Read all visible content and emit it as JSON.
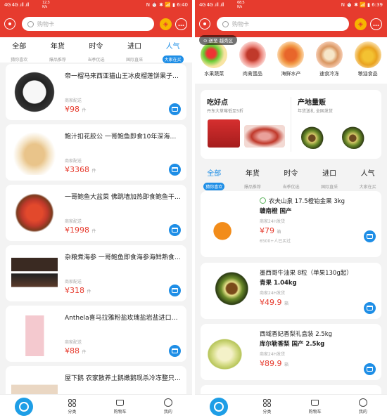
{
  "left": {
    "status": {
      "signal": "4G 4G .ıll .ıll",
      "speed": "12.3\nK/s",
      "time": "6:40",
      "icons": "N ⏰ ✱ 📶 ▮"
    },
    "search_placeholder": "购物卡",
    "tabs": [
      {
        "label": "全部",
        "sub": "猜你喜欢"
      },
      {
        "label": "年货",
        "sub": "爆品推荐"
      },
      {
        "label": "时令",
        "sub": "当季优选"
      },
      {
        "label": "进口",
        "sub": "国际直采"
      },
      {
        "label": "人气",
        "sub": "大家在买"
      }
    ],
    "products": [
      {
        "title": "帝一榴马来西亚猫山王冰皮榴莲饼果子…",
        "store": "商家配送",
        "price": "¥98",
        "unit": "件"
      },
      {
        "title": "鲍汁扣花胶公 一哥鲍鱼即食10年深海…",
        "store": "商家配送",
        "price": "¥3368",
        "unit": "件"
      },
      {
        "title": "一哥鲍鱼大盆菜 佛跳墙加热即食鲍鱼干…",
        "store": "商家配送",
        "price": "¥1998",
        "unit": "件"
      },
      {
        "title": "杂粮煮海参 一哥鲍鱼即食海参海鲜熟食…",
        "store": "商家配送",
        "price": "¥318",
        "unit": "件"
      },
      {
        "title": "Anthela喜马拉雅粉盐玫瑰盐岩盐进口…",
        "store": "商家配送",
        "price": "¥88",
        "unit": "件"
      },
      {
        "title": "屋下鹅 农家散养土鹅嫩鹅现杀冷冻整只…"
      }
    ],
    "nav": [
      "分类",
      "购物车",
      "我的"
    ]
  },
  "right": {
    "status": {
      "signal": "4G 4G .ıll .ıll",
      "speed": "68.5\nK/s",
      "time": "6:39",
      "icons": "N ⏰ ✱ 📶 ▮"
    },
    "search_placeholder": "购物卡",
    "location": "送至 越秀区",
    "categories": [
      "水果蔬菜",
      "肉禽蛋品",
      "海鲜水产",
      "速食冷冻",
      "粮油食品"
    ],
    "promos": [
      {
        "title": "吃好点",
        "sub": "丹东大草莓低至5折"
      },
      {
        "title": "产地量贩",
        "sub": "年货送礼 全国发货"
      }
    ],
    "tabs": [
      {
        "label": "全部",
        "sub": "猜你喜欢"
      },
      {
        "label": "年货",
        "sub": "爆品推荐"
      },
      {
        "label": "时令",
        "sub": "当季优选"
      },
      {
        "label": "进口",
        "sub": "国际直采"
      },
      {
        "label": "人气",
        "sub": "大家在买"
      }
    ],
    "products": [
      {
        "title1": "农夫山泉 17.5橙铂金果 3kg",
        "title2": "赣南橙 国产",
        "store": "商家24H发货",
        "price": "¥79",
        "unit": "箱",
        "sold": "6500+人已买过"
      },
      {
        "title1": "墨西哥牛油果 8粒（单果130g起）",
        "title2": "青果 1.04kg",
        "store": "商家24H发货",
        "price": "¥49.9",
        "unit": "箱"
      },
      {
        "title1": "西域香妃香梨礼盒装 2.5kg",
        "title2": "库尔勒香梨 国产 2.5kg",
        "store": "商家24H发货",
        "price": "¥89.9",
        "unit": "箱"
      }
    ],
    "nav": [
      "分类",
      "购物车",
      "我的"
    ]
  }
}
